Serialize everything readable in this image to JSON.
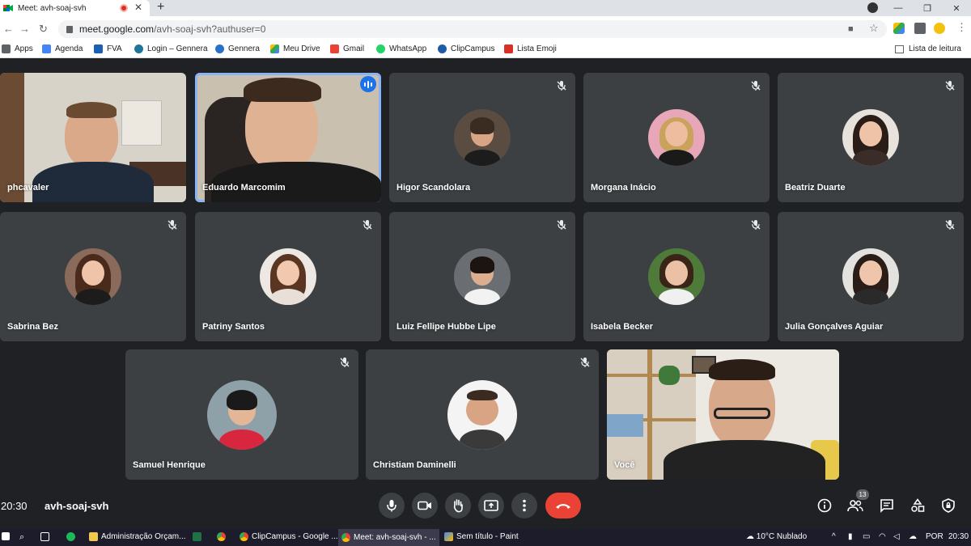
{
  "browser": {
    "tab_title": "Meet: avh-soaj-svh",
    "url_host": "meet.google.com",
    "url_path": "/avh-soaj-svh?authuser=0",
    "bookmarks": [
      {
        "label": "Apps",
        "color": "#5f6368"
      },
      {
        "label": "Agenda",
        "color": "#4285f4"
      },
      {
        "label": "FVA",
        "color": "#1a5fb4"
      },
      {
        "label": "Login – Gennera",
        "color": "#21759b"
      },
      {
        "label": "Gennera",
        "color": "#2a72c7"
      },
      {
        "label": "Meu Drive",
        "color": "#34a853"
      },
      {
        "label": "Gmail",
        "color": "#ea4335"
      },
      {
        "label": "WhatsApp",
        "color": "#25d366"
      },
      {
        "label": "ClipCampus",
        "color": "#1e5aa8"
      },
      {
        "label": "Lista Emoji",
        "color": "#d93025"
      }
    ],
    "reading_list": "Lista de leitura"
  },
  "meeting": {
    "time": "20:30",
    "code": "avh-soaj-svh",
    "participants_count": "13"
  },
  "participants": [
    {
      "name": "phcavaler",
      "type": "video",
      "muted": false
    },
    {
      "name": "Eduardo Marcomim",
      "type": "video",
      "muted": false,
      "speaking": true
    },
    {
      "name": "Higor Scandolara",
      "type": "avatar",
      "muted": true
    },
    {
      "name": "Morgana Inácio",
      "type": "avatar",
      "muted": true
    },
    {
      "name": "Beatriz Duarte",
      "type": "avatar",
      "muted": true
    },
    {
      "name": "Sabrina Bez",
      "type": "avatar",
      "muted": true
    },
    {
      "name": "Patriny Santos",
      "type": "avatar",
      "muted": true
    },
    {
      "name": "Luiz Fellipe Hubbe Lipe",
      "type": "avatar",
      "muted": true
    },
    {
      "name": "Isabela Becker",
      "type": "avatar",
      "muted": true
    },
    {
      "name": "Julia Gonçalves Aguiar",
      "type": "avatar",
      "muted": true
    },
    {
      "name": "Samuel Henrique",
      "type": "avatar",
      "muted": true
    },
    {
      "name": "Christiam Daminelli",
      "type": "avatar",
      "muted": true
    },
    {
      "name": "Você",
      "type": "video",
      "muted": false
    }
  ],
  "taskbar": {
    "items": [
      {
        "label": "Administração Orçam..."
      },
      {
        "label": "ClipCampus - Google ..."
      },
      {
        "label": "Meet: avh-soaj-svh - ..."
      },
      {
        "label": "Sem título - Paint"
      }
    ],
    "weather": "10°C Nublado",
    "language": "POR",
    "clock": "20:30"
  },
  "colors": {
    "accent": "#8ab4f8",
    "end_call": "#ea4335",
    "tile": "#3c4043",
    "background": "#202124"
  }
}
